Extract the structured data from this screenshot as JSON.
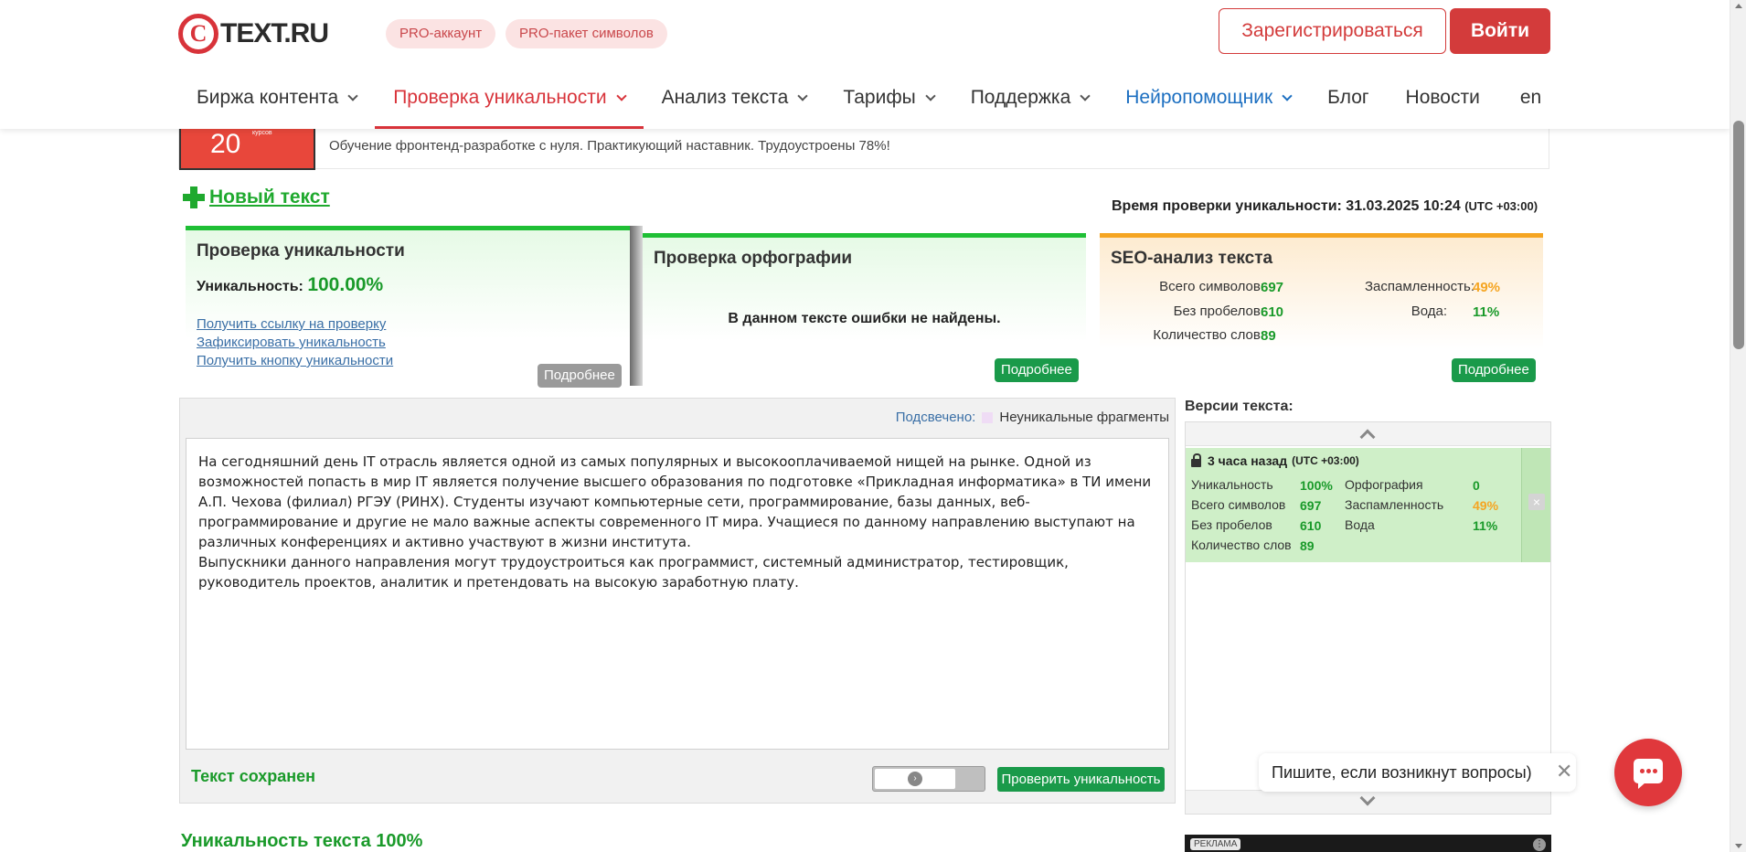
{
  "header": {
    "logo_mark": "C",
    "logo_text": "TEXT.RU",
    "pills": [
      "PRO-аккаунт",
      "PRO-пакет символов"
    ],
    "register_label": "Зарегистрироваться",
    "login_label": "Войти",
    "nav": [
      {
        "label": "Биржа контента",
        "has_dropdown": true
      },
      {
        "label": "Проверка уникальности",
        "has_dropdown": true,
        "active": true
      },
      {
        "label": "Анализ текста",
        "has_dropdown": true
      },
      {
        "label": "Тарифы",
        "has_dropdown": true
      },
      {
        "label": "Поддержка",
        "has_dropdown": true
      },
      {
        "label": "Нейропомощник",
        "has_dropdown": true
      },
      {
        "label": "Блог"
      },
      {
        "label": "Новости"
      },
      {
        "label": "en"
      }
    ]
  },
  "ad_strip": {
    "image_number": "20",
    "image_caption": "курсов",
    "text": "Обучение фронтенд-разработке с нуля. Практикующий наставник. Трудоустроены 78%!"
  },
  "new_text_label": "Новый текст",
  "check_time": {
    "label": "Время проверки уникальности: 31.03.2025 10:24",
    "tz": "(UTC +03:00)"
  },
  "cards": {
    "uniqueness": {
      "title": "Проверка уникальности",
      "label": "Уникальность:",
      "value": "100.00%",
      "links": [
        "Получить ссылку на проверку",
        "Зафиксировать уникальность",
        "Получить кнопку уникальности"
      ],
      "more_label": "Подробнее"
    },
    "spelling": {
      "title": "Проверка орфографии",
      "message": "В данном тексте ошибки не найдены.",
      "more_label": "Подробнее"
    },
    "seo": {
      "title": "SEO-анализ текста",
      "total_chars_label": "Всего символов:",
      "total_chars": "697",
      "no_spaces_label": "Без пробелов:",
      "no_spaces": "610",
      "words_label": "Количество слов:",
      "words": "89",
      "spam_label": "Заспамленность:",
      "spam": "49%",
      "water_label": "Вода:",
      "water": "11%",
      "more_label": "Подробнее"
    }
  },
  "editor": {
    "highlight_label": "Подсвечено:",
    "highlight_legend": "Неуникальные фрагменты",
    "paragraphs": [
      "На сегодняшний день IT отрасль является одной из самых популярных и высокооплачиваемой нищей на рынке. Одной из возможностей попасть в мир IT является получение высшего образования по подготовке «Прикладная информатика» в ТИ имени А.П. Чехова (филиал) РГЭУ (РИНХ). Студенты изучают компьютерные сети, программирование, базы данных, веб-программирование и другие не мало важные аспекты современного IT мира. Учащиеся по данному направлению выступают на различных конференциях и активно участвуют в жизни института.",
      "Выпускники данного направления могут трудоустроиться как программист, системный администратор, тестировщик, руководитель проектов, аналитик и претендовать на высокую заработную плату."
    ],
    "saved_label": "Текст сохранен",
    "check_button": "Проверить уникальность"
  },
  "versions": {
    "title": "Версии текста:",
    "item": {
      "time": "3 часа назад",
      "tz": "(UTC +03:00)",
      "uniq_label": "Уникальность",
      "uniq": "100%",
      "spell_label": "Орфография",
      "spell": "0",
      "total_label": "Всего символов",
      "total": "697",
      "spam_label": "Заспамленность",
      "spam": "49%",
      "nospace_label": "Без пробелов",
      "nospace": "610",
      "water_label": "Вода",
      "water": "11%",
      "words_label": "Количество слов",
      "words": "89"
    }
  },
  "uniq_heading": "Уникальность текста 100%",
  "ad_bottom_badge": "РЕКЛАМА",
  "chat": {
    "prompt": "Пишите, если возникнут вопросы)"
  },
  "colors": {
    "brand_red": "#d8333a",
    "green": "#1a9a2a",
    "orange": "#f5a522",
    "link_blue": "#3a6fa6"
  }
}
